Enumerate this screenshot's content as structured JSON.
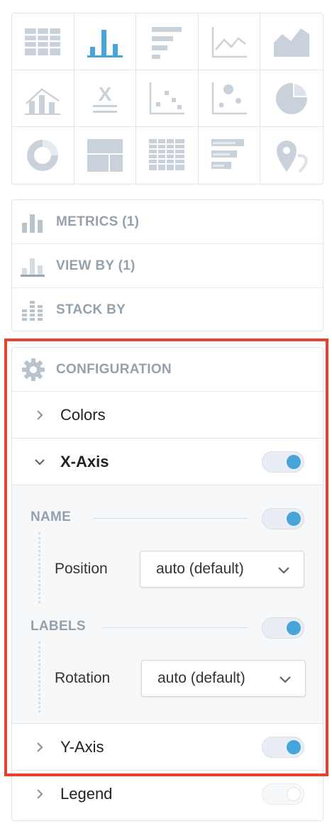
{
  "viz_types": [
    {
      "icon": "table-icon"
    },
    {
      "icon": "column-chart-icon",
      "selected": true
    },
    {
      "icon": "bar-chart-icon"
    },
    {
      "icon": "line-chart-icon"
    },
    {
      "icon": "area-chart-icon"
    },
    {
      "icon": "combo-chart-icon"
    },
    {
      "icon": "headline-icon",
      "glyph": "X"
    },
    {
      "icon": "scatter-plot-icon"
    },
    {
      "icon": "bubble-chart-icon"
    },
    {
      "icon": "pie-chart-icon"
    },
    {
      "icon": "donut-chart-icon"
    },
    {
      "icon": "treemap-icon"
    },
    {
      "icon": "heatmap-icon"
    },
    {
      "icon": "bullet-chart-icon"
    },
    {
      "icon": "geo-chart-icon"
    }
  ],
  "buckets": [
    {
      "label": "METRICS (1)",
      "icon": "metrics-icon"
    },
    {
      "label": "VIEW BY (1)",
      "icon": "view-by-icon"
    },
    {
      "label": "STACK BY",
      "icon": "stack-by-icon"
    }
  ],
  "configuration": {
    "title": "CONFIGURATION",
    "colors": {
      "label": "Colors"
    },
    "x_axis": {
      "label": "X-Axis",
      "enabled": true,
      "name": {
        "title": "NAME",
        "enabled": true,
        "position_label": "Position",
        "position_value": "auto (default)"
      },
      "labels": {
        "title": "LABELS",
        "enabled": true,
        "rotation_label": "Rotation",
        "rotation_value": "auto (default)"
      }
    },
    "y_axis": {
      "label": "Y-Axis",
      "enabled": true
    },
    "legend": {
      "label": "Legend",
      "enabled": false
    }
  },
  "colors": {
    "accent": "#46a4d9",
    "muted_icon": "#c9d1da",
    "highlight": "#e5432d"
  }
}
